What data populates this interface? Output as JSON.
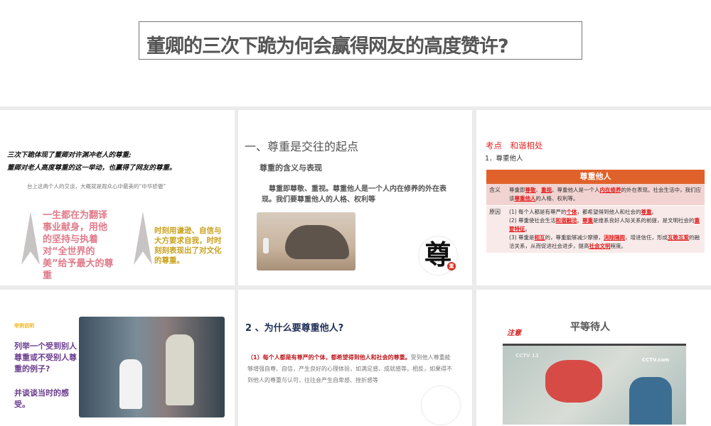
{
  "header": {
    "title": "董卿的三次下跪为何会赢得网友的高度赞许?"
  },
  "slides": [
    {
      "line1": "三次下跪体现了董卿对许渊冲老人的尊重;",
      "line2": "董卿对老人高度尊重的这一举动，也赢得了网友的尊重。",
      "caption": "台上这两个人的交谈，大概就是观众心中最美的“中华骄傲”",
      "pink_text": "一生都在为翻译事业献身，用他的坚持与执着对“全世界的美”给予最大的尊重",
      "gold_text": "时刻用谦逊、自信与大方要求自我，时时刻刻表现出了对文化的尊重。"
    },
    {
      "heading": "一、尊重是交往的起点",
      "subheading": "尊重的含义与表现",
      "body": "尊重即尊敬、重视。尊重他人是一个人内在修养的外在表现。我们要尊重他人的人格、权利等",
      "seal_char": "尊",
      "seal_small": "重"
    },
    {
      "kaodian": "考点　和谐相处",
      "item": "1．尊重他人",
      "table_title": "尊重他人",
      "rows": [
        {
          "key": "含义"
        },
        {
          "key": "原因"
        }
      ]
    },
    {
      "label": "举例说明",
      "q1": "列举一个受到别人尊重或不受别人尊重的例子?",
      "q2": "并谈谈当时的感受。"
    },
    {
      "heading": "2 、为什么要尊重他人?",
      "red": "（1）每个人都是有尊严的个体，都希望得到他人和社会的尊重。",
      "body": "受到他人尊重能够增强自尊、自信，产生良好的心理体验，如满足感、成就感等。相反，如果得不到他人的尊重与认可，往往会产生自卑感、挫折感等"
    },
    {
      "note": "注意",
      "heading": "平等待人",
      "tv_logo": "CCTV 13",
      "tv_brand": "CCTV.com"
    }
  ]
}
